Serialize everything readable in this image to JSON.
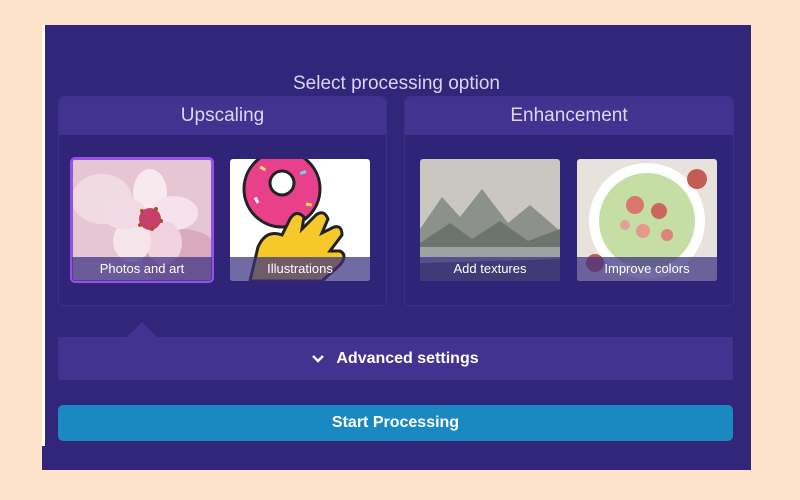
{
  "panel": {
    "title": "Select processing option"
  },
  "groups": [
    {
      "title": "Upscaling",
      "tiles": [
        {
          "label": "Photos and art",
          "selected": true,
          "icon": "cherry-blossom-image"
        },
        {
          "label": "Illustrations",
          "selected": false,
          "icon": "donut-illustration-image"
        }
      ]
    },
    {
      "title": "Enhancement",
      "tiles": [
        {
          "label": "Add textures",
          "selected": false,
          "icon": "misty-lake-image"
        },
        {
          "label": "Improve colors",
          "selected": false,
          "icon": "smoothie-bowl-image"
        }
      ]
    }
  ],
  "advanced": {
    "label": "Advanced settings",
    "icon": "chevron-down-icon"
  },
  "start": {
    "label": "Start Processing"
  },
  "colors": {
    "page_bg": "#fde3c9",
    "panel_bg": "#32267a",
    "group_header": "#41338f",
    "selected_outline": "#9553e6",
    "primary_button": "#1a89c1"
  }
}
